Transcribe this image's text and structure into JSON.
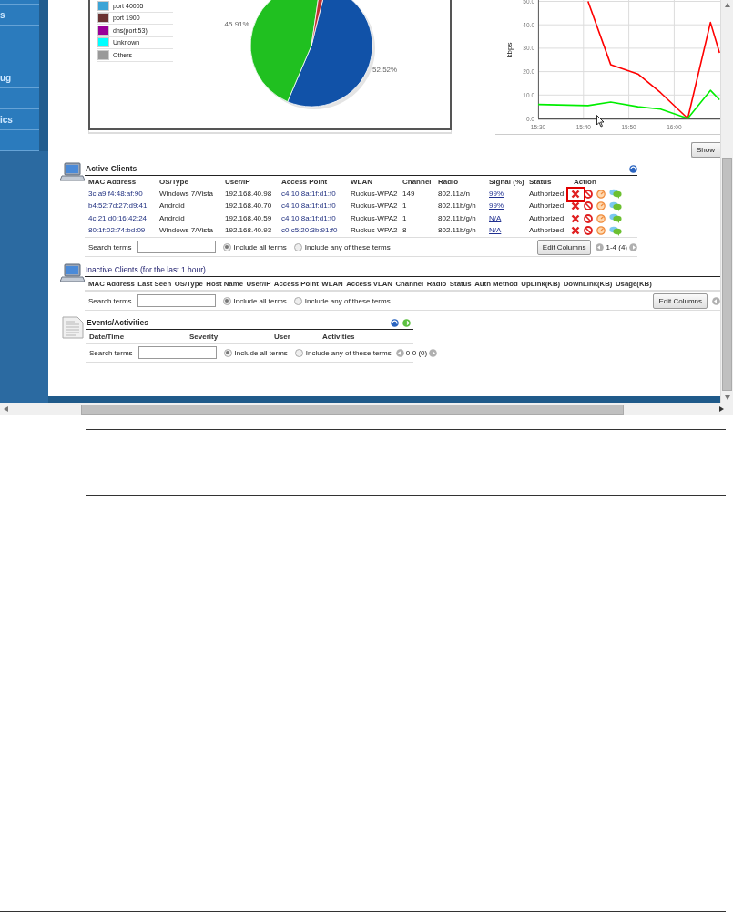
{
  "sidebar": {
    "items": [
      {
        "kind": "blank"
      },
      {
        "kind": "text",
        "label": "s"
      },
      {
        "kind": "blank"
      },
      {
        "kind": "blank"
      },
      {
        "kind": "text",
        "label": "ug"
      },
      {
        "kind": "blank"
      },
      {
        "kind": "text",
        "label": "ics"
      },
      {
        "kind": "blank"
      }
    ]
  },
  "pie_panel": {
    "legend": [
      {
        "label": "port 40005",
        "color": "#3ca4d6"
      },
      {
        "label": "port 1900",
        "color": "#6b3333"
      },
      {
        "label": "dns(port 53)",
        "color": "#990099"
      },
      {
        "label": "Unknown",
        "color": "#00ffff"
      },
      {
        "label": "Others",
        "color": "#999999"
      }
    ],
    "chart_data": {
      "type": "pie",
      "values": [
        52.52,
        45.91,
        1.57
      ],
      "value_labels": [
        "52.52%",
        "45.91%",
        null
      ]
    }
  },
  "traffic_chart": {
    "chart_data": {
      "type": "line",
      "ylabel": "kbps",
      "x": [
        930,
        941,
        946,
        952,
        957,
        963,
        968,
        970
      ],
      "series": [
        {
          "color": "#ff0000",
          "values": [
            null,
            50,
            23,
            19,
            11,
            0,
            41,
            28
          ]
        },
        {
          "color": "#00ee00",
          "values": [
            6,
            5.5,
            7,
            5,
            4,
            0,
            12,
            8
          ]
        }
      ],
      "xlim": [
        930,
        970
      ],
      "ylim": [
        0,
        50
      ],
      "grid": true,
      "xticks": [
        {
          "value": 930,
          "label": "15:30"
        },
        {
          "value": 940,
          "label": "15:40"
        },
        {
          "value": 950,
          "label": "15:50"
        },
        {
          "value": 960,
          "label": "16:00"
        }
      ],
      "yticks": [
        {
          "value": 0,
          "label": "0.0"
        },
        {
          "value": 10,
          "label": "10.0"
        },
        {
          "value": 20,
          "label": "20.0"
        },
        {
          "value": 30,
          "label": "30.0"
        },
        {
          "value": 40,
          "label": "40.0"
        },
        {
          "value": 50,
          "label": "50.0"
        }
      ]
    },
    "show_button": "Show"
  },
  "active_clients": {
    "title": "Active Clients",
    "columns": [
      "MAC Address",
      "OS/Type",
      "User/IP",
      "Access Point",
      "WLAN",
      "Channel",
      "Radio",
      "Signal (%)",
      "Status",
      "Action"
    ],
    "rows": [
      {
        "cells": [
          "3c:a9:f4:48:af:90",
          "Windows 7/Vista",
          "192.168.40.98",
          "c4:10:8a:1f:d1:f0",
          "Ruckus-WPA2",
          "149",
          "802.11a/n",
          "99%",
          "Authorized"
        ],
        "highlighted": true
      },
      {
        "cells": [
          "b4:52:7d:27:d9:41",
          "Android",
          "192.168.40.70",
          "c4:10:8a:1f:d1:f0",
          "Ruckus-WPA2",
          "1",
          "802.11b/g/n",
          "99%",
          "Authorized"
        ],
        "highlighted": false
      },
      {
        "cells": [
          "4c:21:d0:16:42:24",
          "Android",
          "192.168.40.59",
          "c4:10:8a:1f:d1:f0",
          "Ruckus-WPA2",
          "1",
          "802.11b/g/n",
          "N/A",
          "Authorized"
        ],
        "highlighted": false
      },
      {
        "cells": [
          "80:1f:02:74:bd:09",
          "Windows 7/Vista",
          "192.168.40.93",
          "c0:c5:20:3b:91:f0",
          "Ruckus-WPA2",
          "8",
          "802.11b/g/n",
          "N/A",
          "Authorized"
        ],
        "highlighted": false
      }
    ],
    "search": {
      "label": "Search terms",
      "options": [
        {
          "label": "Include all terms",
          "selected": true
        },
        {
          "label": "Include any of these terms",
          "selected": false
        }
      ]
    },
    "edit_button": "Edit Columns",
    "pager": "1-4 (4)"
  },
  "inactive_clients": {
    "title": "Inactive Clients (for the last 1 hour)",
    "columns": [
      "MAC Address",
      "Last Seen",
      "OS/Type",
      "Host Name",
      "User/IP",
      "Access Point",
      "WLAN",
      "Access VLAN",
      "Channel",
      "Radio",
      "Status",
      "Auth Method",
      "UpLink(KB)",
      "DownLink(KB)",
      "Usage(KB)"
    ],
    "search": {
      "label": "Search terms",
      "options": [
        {
          "label": "Include all terms",
          "selected": true
        },
        {
          "label": "Include any of these terms",
          "selected": false
        }
      ]
    },
    "edit_button": "Edit Columns"
  },
  "events": {
    "title": "Events/Activities",
    "columns": [
      "Date/Time",
      "Severity",
      "User",
      "Activities"
    ],
    "search": {
      "label": "Search terms",
      "options": [
        {
          "label": "Include all terms",
          "selected": true
        },
        {
          "label": "Include any of these terms",
          "selected": false
        }
      ]
    },
    "pager": "0-0 (0)"
  }
}
